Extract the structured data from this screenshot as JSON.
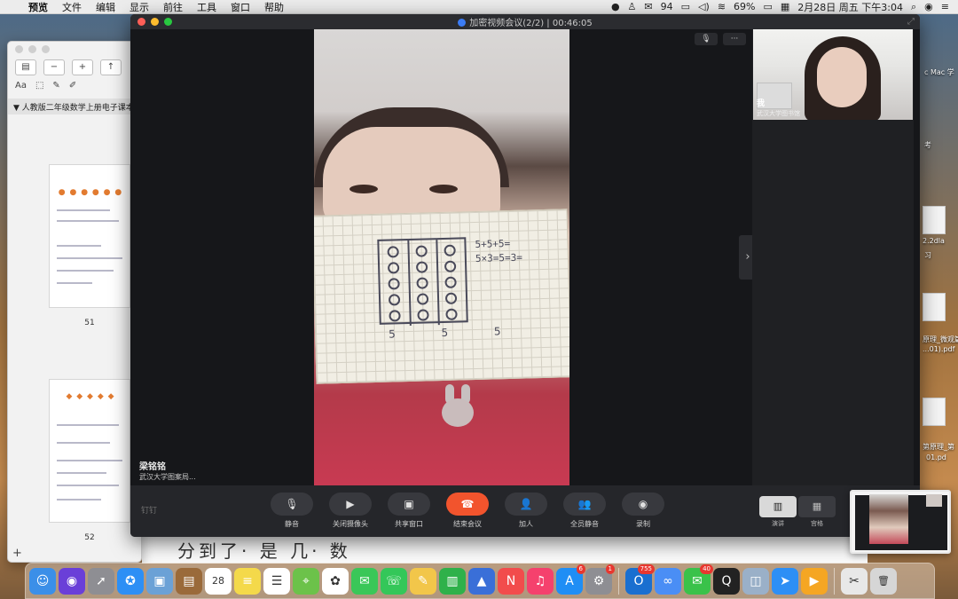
{
  "menubar": {
    "apple_icon": "apple-icon",
    "items": [
      "预览",
      "文件",
      "编辑",
      "显示",
      "前往",
      "工具",
      "窗口",
      "帮助"
    ],
    "status": {
      "battery": "69%",
      "datetime": "2月28日 周五 下午3:04",
      "qq_count": "94"
    }
  },
  "preview_window": {
    "doc_title": "人教版二年级数学上册电子课本",
    "pages": [
      {
        "label": "51"
      },
      {
        "label": "52"
      }
    ],
    "add": "+"
  },
  "meeting": {
    "title": "加密视频会议(2/2) | 00:46:05",
    "speaker": {
      "name": "梁铭铭",
      "org": "武汉大学图案局..."
    },
    "paper": {
      "formula1": "5+5+5=",
      "formula2": "5×3=5=3=",
      "bottom": "5 5 5"
    },
    "participant": {
      "name": "我",
      "org": "武汉大学图书馆"
    },
    "logo": "钉钉",
    "controls": [
      {
        "id": "mute",
        "label": "静音",
        "icon": "microphone-icon"
      },
      {
        "id": "camera",
        "label": "关闭摄像头",
        "icon": "camera-icon"
      },
      {
        "id": "share",
        "label": "共享窗口",
        "icon": "share-screen-icon"
      },
      {
        "id": "end",
        "label": "结束会议",
        "icon": "hangup-icon"
      },
      {
        "id": "invite",
        "label": "加人",
        "icon": "add-person-icon"
      },
      {
        "id": "mute-all",
        "label": "全员静音",
        "icon": "mute-all-icon"
      },
      {
        "id": "record",
        "label": "录制",
        "icon": "record-icon"
      }
    ],
    "layout": [
      {
        "id": "speaker",
        "label": "演讲",
        "active": true
      },
      {
        "id": "grid",
        "label": "宫格",
        "active": false
      }
    ]
  },
  "desktop": {
    "items": [
      {
        "label": "c Mac 学"
      },
      {
        "label": "考"
      },
      {
        "label": "2.2dla"
      },
      {
        "label": "习"
      },
      {
        "label": "原理_微观篇"
      },
      {
        "label": "...01).pdf"
      },
      {
        "label": "第原理_第"
      },
      {
        "label": "01.pd"
      }
    ]
  },
  "bg_document": {
    "text": "分到了·  是  几·   数"
  },
  "dock": {
    "apps": [
      {
        "name": "finder",
        "color": "#3b8fe8",
        "glyph": "☺"
      },
      {
        "name": "siri",
        "color": "#6a3fd8",
        "glyph": "◉"
      },
      {
        "name": "launchpad",
        "color": "#8e8e93",
        "glyph": "➚"
      },
      {
        "name": "safari",
        "color": "#2d8ff5",
        "glyph": "✪"
      },
      {
        "name": "preview",
        "color": "#6ba1d6",
        "glyph": "▣"
      },
      {
        "name": "notes-brown",
        "color": "#9a6a3a",
        "glyph": "▤"
      },
      {
        "name": "calendar",
        "color": "#ffffff",
        "glyph": "28",
        "dark": true
      },
      {
        "name": "notes",
        "color": "#f4d94a",
        "glyph": "≡"
      },
      {
        "name": "reminders",
        "color": "#ffffff",
        "glyph": "☰",
        "dark": true
      },
      {
        "name": "maps",
        "color": "#6cc24a",
        "glyph": "⌖"
      },
      {
        "name": "photos",
        "color": "#ffffff",
        "glyph": "✿",
        "dark": true
      },
      {
        "name": "messages",
        "color": "#3ac758",
        "glyph": "✉"
      },
      {
        "name": "facetime",
        "color": "#34c759",
        "glyph": "☏"
      },
      {
        "name": "stickies",
        "color": "#f2c64a",
        "glyph": "✎"
      },
      {
        "name": "numbers",
        "color": "#2fb14a",
        "glyph": "▥"
      },
      {
        "name": "keynote",
        "color": "#3a6fd8",
        "glyph": "▲"
      },
      {
        "name": "news",
        "color": "#f24c4c",
        "glyph": "N"
      },
      {
        "name": "music",
        "color": "#f5416d",
        "glyph": "♫"
      },
      {
        "name": "app-store",
        "color": "#1f8ef5",
        "glyph": "A",
        "badge": "6"
      },
      {
        "name": "system-preferences",
        "color": "#8e8e93",
        "glyph": "⚙",
        "badge": "1"
      },
      {
        "sep": true
      },
      {
        "name": "outlook",
        "color": "#1a6fd0",
        "glyph": "O",
        "badge": "755"
      },
      {
        "name": "baidu-netdisk",
        "color": "#4a8ef5",
        "glyph": "∞"
      },
      {
        "name": "wechat",
        "color": "#3ac24a",
        "glyph": "✉",
        "badge": "40"
      },
      {
        "name": "qq",
        "color": "#222222",
        "glyph": "Q"
      },
      {
        "name": "image-capture",
        "color": "#9ab0c8",
        "glyph": "◫"
      },
      {
        "name": "feishu",
        "color": "#2d8ff5",
        "glyph": "➤"
      },
      {
        "name": "infuse",
        "color": "#f5a623",
        "glyph": "▶"
      },
      {
        "sep": true
      },
      {
        "name": "screenshot-tool",
        "color": "#e8e8e8",
        "glyph": "✂",
        "dark": true
      },
      {
        "name": "trash",
        "color": "#d6d6d6",
        "glyph": "🗑",
        "dark": true
      }
    ]
  }
}
